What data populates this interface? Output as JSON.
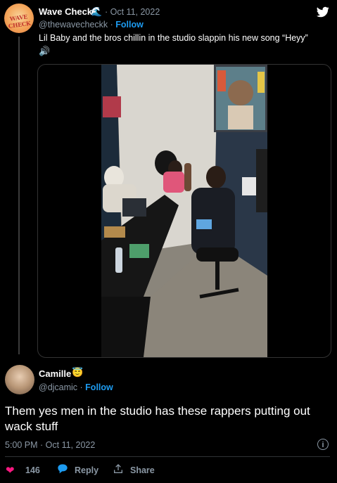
{
  "quoted_tweet": {
    "avatar_text": "WAVE CHECK",
    "name": "Wave Check",
    "name_emoji": "🌊",
    "date": "· Oct 11, 2022",
    "handle": "@thewavecheckk",
    "separator": " · ",
    "follow_label": "Follow",
    "text": "Lil Baby and the bros chillin in the studio slappin his new song “Heyy”",
    "speaker_emoji": "🔊",
    "icon": "twitter-bird-icon"
  },
  "reply_tweet": {
    "name": "Camille",
    "name_emoji": "😇",
    "handle": "@djcamic",
    "separator": " · ",
    "follow_label": "Follow",
    "text": "Them yes men in the studio has these rappers putting out wack stuff",
    "timestamp": "5:00 PM · Oct 11, 2022",
    "info_glyph": "i",
    "like_count": "146",
    "reply_label": "Reply",
    "share_label": "Share"
  },
  "colors": {
    "background": "#000000",
    "muted_text": "#8b98a5",
    "link_blue": "#1d9bf0",
    "like_pink": "#f91880"
  }
}
